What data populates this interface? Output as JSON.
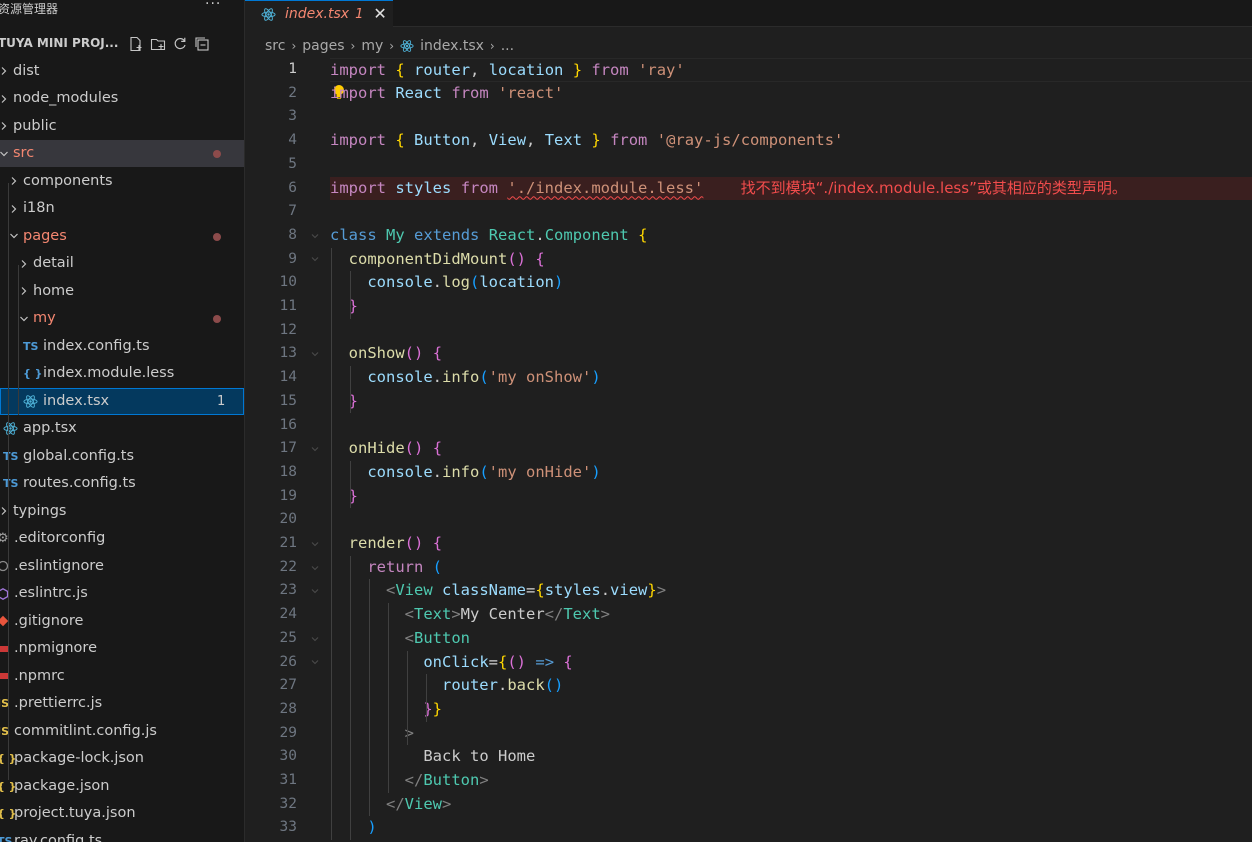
{
  "sidebar": {
    "title": "资源管理器",
    "more": "···",
    "project": "TUYA MINI PROJ...",
    "tree": [
      {
        "label": "dist",
        "kind": "folder",
        "depth": 0,
        "state": "closed"
      },
      {
        "label": "node_modules",
        "kind": "folder",
        "depth": 0,
        "state": "closed"
      },
      {
        "label": "public",
        "kind": "folder",
        "depth": 0,
        "state": "closed"
      },
      {
        "label": "src",
        "kind": "folder",
        "depth": 0,
        "state": "open",
        "modified": true
      },
      {
        "label": "components",
        "kind": "folder",
        "depth": 1,
        "state": "closed"
      },
      {
        "label": "i18n",
        "kind": "folder",
        "depth": 1,
        "state": "closed"
      },
      {
        "label": "pages",
        "kind": "folder",
        "depth": 1,
        "state": "open",
        "modified": true
      },
      {
        "label": "detail",
        "kind": "folder",
        "depth": 2,
        "state": "closed"
      },
      {
        "label": "home",
        "kind": "folder",
        "depth": 2,
        "state": "closed"
      },
      {
        "label": "my",
        "kind": "folder",
        "depth": 2,
        "state": "open",
        "modified": true
      },
      {
        "label": "index.config.ts",
        "kind": "file",
        "depth": 3,
        "icon": "TS"
      },
      {
        "label": "index.module.less",
        "kind": "file",
        "depth": 3,
        "icon": "{}"
      },
      {
        "label": "index.tsx",
        "kind": "file",
        "depth": 3,
        "icon": "react",
        "badge": "1"
      },
      {
        "label": "app.tsx",
        "kind": "file",
        "depth": 1,
        "icon": "react"
      },
      {
        "label": "global.config.ts",
        "kind": "file",
        "depth": 1,
        "icon": "TS"
      },
      {
        "label": "routes.config.ts",
        "kind": "file",
        "depth": 1,
        "icon": "TS"
      },
      {
        "label": "typings",
        "kind": "folder",
        "depth": 0,
        "state": "closed"
      },
      {
        "label": ".editorconfig",
        "kind": "file",
        "depth": 0,
        "icon": "gear"
      },
      {
        "label": ".eslintignore",
        "kind": "file",
        "depth": 0,
        "icon": "circle"
      },
      {
        "label": ".eslintrc.js",
        "kind": "file",
        "depth": 0,
        "icon": "eslint"
      },
      {
        "label": ".gitignore",
        "kind": "file",
        "depth": 0,
        "icon": "git"
      },
      {
        "label": ".npmignore",
        "kind": "file",
        "depth": 0,
        "icon": "npm"
      },
      {
        "label": ".npmrc",
        "kind": "file",
        "depth": 0,
        "icon": "npm"
      },
      {
        "label": ".prettierrc.js",
        "kind": "file",
        "depth": 0,
        "icon": "JS"
      },
      {
        "label": "commitlint.config.js",
        "kind": "file",
        "depth": 0,
        "icon": "JS"
      },
      {
        "label": "package-lock.json",
        "kind": "file",
        "depth": 0,
        "icon": "json"
      },
      {
        "label": "package.json",
        "kind": "file",
        "depth": 0,
        "icon": "json"
      },
      {
        "label": "project.tuya.json",
        "kind": "file",
        "depth": 0,
        "icon": "json"
      },
      {
        "label": "ray.config.ts",
        "kind": "file",
        "depth": 0,
        "icon": "TS"
      }
    ]
  },
  "tab": {
    "name": "index.tsx",
    "problems": "1",
    "close": "✕"
  },
  "breadcrumb": [
    "src",
    "pages",
    "my",
    "index.tsx",
    "..."
  ],
  "editor": {
    "current_line": 1,
    "error_line": 6,
    "error_message": "找不到模块“./index.module.less”或其相应的类型声明。",
    "lines": [
      [
        [
          "kw",
          "import"
        ],
        [
          "p",
          " "
        ],
        [
          "b1",
          "{"
        ],
        [
          "p",
          " "
        ],
        [
          "vr",
          "router"
        ],
        [
          "p",
          ", "
        ],
        [
          "vr",
          "location"
        ],
        [
          "p",
          " "
        ],
        [
          "b1",
          "}"
        ],
        [
          "p",
          " "
        ],
        [
          "kw",
          "from"
        ],
        [
          "p",
          " "
        ],
        [
          "st",
          "'ray'"
        ]
      ],
      [
        [
          "kw",
          "import"
        ],
        [
          "p",
          " "
        ],
        [
          "vr",
          "React"
        ],
        [
          "p",
          " "
        ],
        [
          "kw",
          "from"
        ],
        [
          "p",
          " "
        ],
        [
          "st",
          "'react'"
        ]
      ],
      [],
      [
        [
          "kw",
          "import"
        ],
        [
          "p",
          " "
        ],
        [
          "b1",
          "{"
        ],
        [
          "p",
          " "
        ],
        [
          "vr",
          "Button"
        ],
        [
          "p",
          ", "
        ],
        [
          "vr",
          "View"
        ],
        [
          "p",
          ", "
        ],
        [
          "vr",
          "Text"
        ],
        [
          "p",
          " "
        ],
        [
          "b1",
          "}"
        ],
        [
          "p",
          " "
        ],
        [
          "kw",
          "from"
        ],
        [
          "p",
          " "
        ],
        [
          "st",
          "'@ray-js/components'"
        ]
      ],
      [],
      [
        [
          "kw",
          "import"
        ],
        [
          "p",
          " "
        ],
        [
          "vr",
          "styles"
        ],
        [
          "p",
          " "
        ],
        [
          "kw",
          "from"
        ],
        [
          "p",
          " "
        ],
        [
          "sq",
          "'./index.module.less'"
        ],
        [
          "p",
          "    "
        ],
        [
          "err",
          ""
        ]
      ],
      [],
      [
        [
          "kb",
          "class"
        ],
        [
          "p",
          " "
        ],
        [
          "cls",
          "My"
        ],
        [
          "p",
          " "
        ],
        [
          "kb",
          "extends"
        ],
        [
          "p",
          " "
        ],
        [
          "cls",
          "React"
        ],
        [
          "p",
          "."
        ],
        [
          "cls",
          "Component"
        ],
        [
          "p",
          " "
        ],
        [
          "b1",
          "{"
        ]
      ],
      [
        [
          "p",
          "  "
        ],
        [
          "fn",
          "componentDidMount"
        ],
        [
          "b2",
          "()"
        ],
        [
          "p",
          " "
        ],
        [
          "b2",
          "{"
        ]
      ],
      [
        [
          "p",
          "    "
        ],
        [
          "vr",
          "console"
        ],
        [
          "p",
          "."
        ],
        [
          "fn",
          "log"
        ],
        [
          "b3",
          "("
        ],
        [
          "vr",
          "location"
        ],
        [
          "b3",
          ")"
        ]
      ],
      [
        [
          "p",
          "  "
        ],
        [
          "b2",
          "}"
        ]
      ],
      [],
      [
        [
          "p",
          "  "
        ],
        [
          "fn",
          "onShow"
        ],
        [
          "b2",
          "()"
        ],
        [
          "p",
          " "
        ],
        [
          "b2",
          "{"
        ]
      ],
      [
        [
          "p",
          "    "
        ],
        [
          "vr",
          "console"
        ],
        [
          "p",
          "."
        ],
        [
          "fn",
          "info"
        ],
        [
          "b3",
          "("
        ],
        [
          "st",
          "'my onShow'"
        ],
        [
          "b3",
          ")"
        ]
      ],
      [
        [
          "p",
          "  "
        ],
        [
          "b2",
          "}"
        ]
      ],
      [],
      [
        [
          "p",
          "  "
        ],
        [
          "fn",
          "onHide"
        ],
        [
          "b2",
          "()"
        ],
        [
          "p",
          " "
        ],
        [
          "b2",
          "{"
        ]
      ],
      [
        [
          "p",
          "    "
        ],
        [
          "vr",
          "console"
        ],
        [
          "p",
          "."
        ],
        [
          "fn",
          "info"
        ],
        [
          "b3",
          "("
        ],
        [
          "st",
          "'my onHide'"
        ],
        [
          "b3",
          ")"
        ]
      ],
      [
        [
          "p",
          "  "
        ],
        [
          "b2",
          "}"
        ]
      ],
      [],
      [
        [
          "p",
          "  "
        ],
        [
          "fn",
          "render"
        ],
        [
          "b2",
          "()"
        ],
        [
          "p",
          " "
        ],
        [
          "b2",
          "{"
        ]
      ],
      [
        [
          "p",
          "    "
        ],
        [
          "kw",
          "return"
        ],
        [
          "p",
          " "
        ],
        [
          "b3",
          "("
        ]
      ],
      [
        [
          "p",
          "      "
        ],
        [
          "tg",
          "<"
        ],
        [
          "tn",
          "View"
        ],
        [
          "p",
          " "
        ],
        [
          "at",
          "className"
        ],
        [
          "pn",
          "="
        ],
        [
          "b1",
          "{"
        ],
        [
          "vr",
          "styles"
        ],
        [
          "p",
          "."
        ],
        [
          "vr",
          "view"
        ],
        [
          "b1",
          "}"
        ],
        [
          "tg",
          ">"
        ]
      ],
      [
        [
          "p",
          "        "
        ],
        [
          "tg",
          "<"
        ],
        [
          "tn",
          "Text"
        ],
        [
          "tg",
          ">"
        ],
        [
          "p",
          "My Center"
        ],
        [
          "tg",
          "</"
        ],
        [
          "tn",
          "Text"
        ],
        [
          "tg",
          ">"
        ]
      ],
      [
        [
          "p",
          "        "
        ],
        [
          "tg",
          "<"
        ],
        [
          "tn",
          "Button"
        ]
      ],
      [
        [
          "p",
          "          "
        ],
        [
          "at",
          "onClick"
        ],
        [
          "pn",
          "="
        ],
        [
          "b1",
          "{"
        ],
        [
          "b2",
          "()"
        ],
        [
          "p",
          " "
        ],
        [
          "kb",
          "=>"
        ],
        [
          "p",
          " "
        ],
        [
          "b2",
          "{"
        ]
      ],
      [
        [
          "p",
          "            "
        ],
        [
          "vr",
          "router"
        ],
        [
          "p",
          "."
        ],
        [
          "fn",
          "back"
        ],
        [
          "b3",
          "()"
        ]
      ],
      [
        [
          "p",
          "          "
        ],
        [
          "b2",
          "}"
        ],
        [
          "b1",
          "}"
        ]
      ],
      [
        [
          "p",
          "        "
        ],
        [
          "tg",
          ">"
        ]
      ],
      [
        [
          "p",
          "          "
        ],
        [
          "p",
          "Back to Home"
        ]
      ],
      [
        [
          "p",
          "        "
        ],
        [
          "tg",
          "</"
        ],
        [
          "tn",
          "Button"
        ],
        [
          "tg",
          ">"
        ]
      ],
      [
        [
          "p",
          "      "
        ],
        [
          "tg",
          "</"
        ],
        [
          "tn",
          "View"
        ],
        [
          "tg",
          ">"
        ]
      ],
      [
        [
          "p",
          "    "
        ],
        [
          "b3",
          ")"
        ]
      ]
    ],
    "line_numbers": [
      "1",
      "2",
      "3",
      "4",
      "5",
      "6",
      "7",
      "8",
      "9",
      "10",
      "11",
      "12",
      "13",
      "14",
      "15",
      "16",
      "17",
      "18",
      "19",
      "20",
      "21",
      "22",
      "23",
      "24",
      "25",
      "26",
      "27",
      "28",
      "29",
      "30",
      "31",
      "32",
      "33"
    ]
  }
}
